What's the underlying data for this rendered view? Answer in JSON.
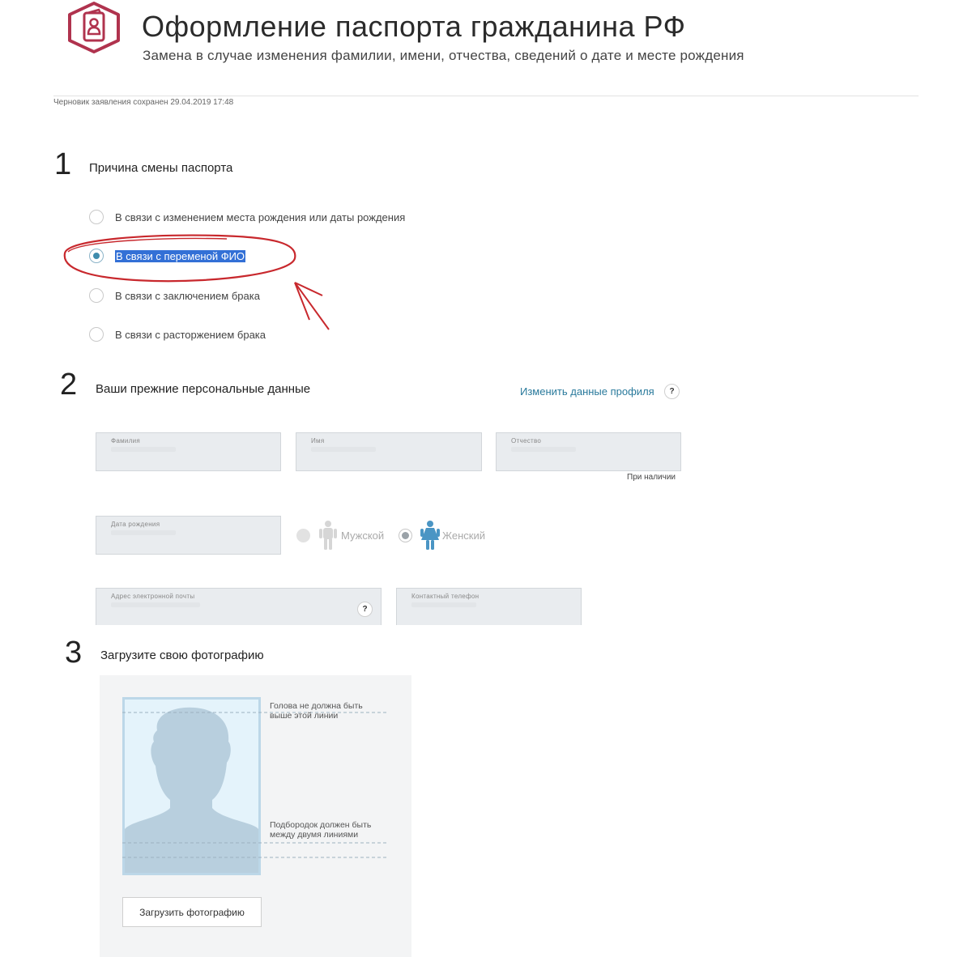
{
  "header": {
    "title": "Оформление паспорта гражданина РФ",
    "subtitle": "Замена в случае изменения фамилии, имени, отчества, сведений о дате и месте рождения",
    "logo_icon": "passport-person-icon",
    "accent_color": "#b0334e"
  },
  "draft_status": "Черновик заявления сохранен 29.04.2019 17:48",
  "step1": {
    "number": "1",
    "title": "Причина смены паспорта",
    "options": [
      {
        "label": "В связи с изменением места рождения или даты рождения",
        "checked": false
      },
      {
        "label": "В связи с переменой ФИО",
        "checked": true
      },
      {
        "label": "В связи с заключением брака",
        "checked": false
      },
      {
        "label": "В связи с расторжением брака",
        "checked": false
      }
    ]
  },
  "step2": {
    "number": "2",
    "title": "Ваши прежние персональные данные",
    "edit_profile_link": "Изменить данные профиля",
    "help": "?",
    "fields": {
      "last_name": "Фамилия",
      "first_name": "Имя",
      "middle_name": "Отчество",
      "middle_name_hint": "При наличии",
      "birth_date": "Дата рождения",
      "email": "Адрес электронной почты",
      "phone": "Контактный телефон"
    },
    "gender": {
      "male": "Мужской",
      "female": "Женский",
      "selected": "female"
    }
  },
  "step3": {
    "number": "3",
    "title": "Загрузите свою фотографию",
    "note_top": "Голова не должна быть выше этой линии",
    "note_bottom": "Подбородок должен быть между двумя линиями",
    "upload_button": "Загрузить фотографию"
  },
  "annotation": {
    "color": "#c8282d"
  }
}
